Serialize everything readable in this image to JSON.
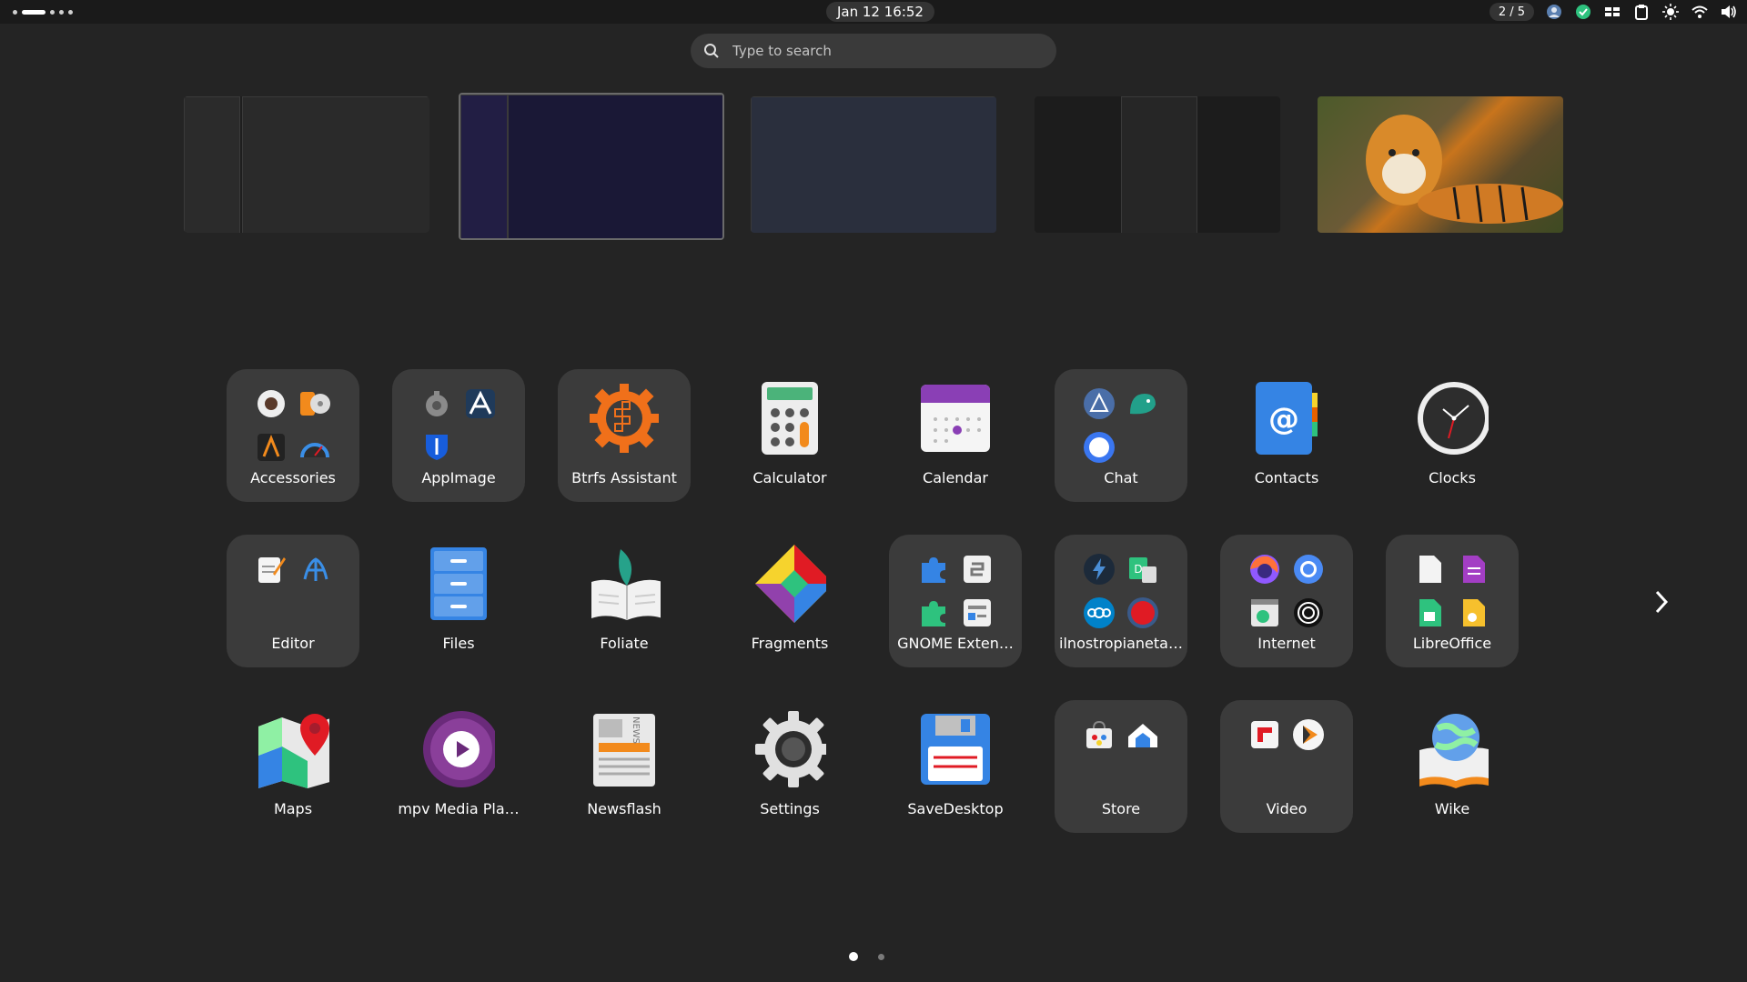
{
  "topbar": {
    "datetime": "Jan 12  16:52",
    "workspace_indicator": "2 / 5",
    "tray_icons": [
      "avatar-icon",
      "check-icon",
      "layout-icon",
      "clipboard-icon",
      "brightness-icon",
      "wifi-icon",
      "volume-icon"
    ]
  },
  "search": {
    "placeholder": "Type to search"
  },
  "workspaces": [
    "workspace-1",
    "workspace-2",
    "workspace-3",
    "workspace-4",
    "workspace-5"
  ],
  "apps": [
    {
      "label": "Accessories",
      "folder": true
    },
    {
      "label": "AppImage",
      "folder": true
    },
    {
      "label": "Btrfs Assistant",
      "folder": false
    },
    {
      "label": "Calculator",
      "folder": false
    },
    {
      "label": "Calendar",
      "folder": false
    },
    {
      "label": "Chat",
      "folder": true
    },
    {
      "label": "Contacts",
      "folder": false
    },
    {
      "label": "Clocks",
      "folder": false
    },
    {
      "label": "Editor",
      "folder": true
    },
    {
      "label": "Files",
      "folder": false
    },
    {
      "label": "Foliate",
      "folder": false
    },
    {
      "label": "Fragments",
      "folder": false
    },
    {
      "label": "GNOME Exten…",
      "folder": true
    },
    {
      "label": "ilnostropianeta…",
      "folder": true
    },
    {
      "label": "Internet",
      "folder": true
    },
    {
      "label": "LibreOffice",
      "folder": true
    },
    {
      "label": "Maps",
      "folder": false
    },
    {
      "label": "mpv Media Pla…",
      "folder": false
    },
    {
      "label": "Newsflash",
      "folder": false
    },
    {
      "label": "Settings",
      "folder": false
    },
    {
      "label": "SaveDesktop",
      "folder": false
    },
    {
      "label": "Store",
      "folder": true
    },
    {
      "label": "Video",
      "folder": true
    },
    {
      "label": "Wike",
      "folder": false
    }
  ],
  "pager": {
    "pages": 2,
    "current": 1
  },
  "colors": {
    "background": "#242424",
    "folder": "#3b3b3b",
    "search": "#3a3a3a"
  }
}
